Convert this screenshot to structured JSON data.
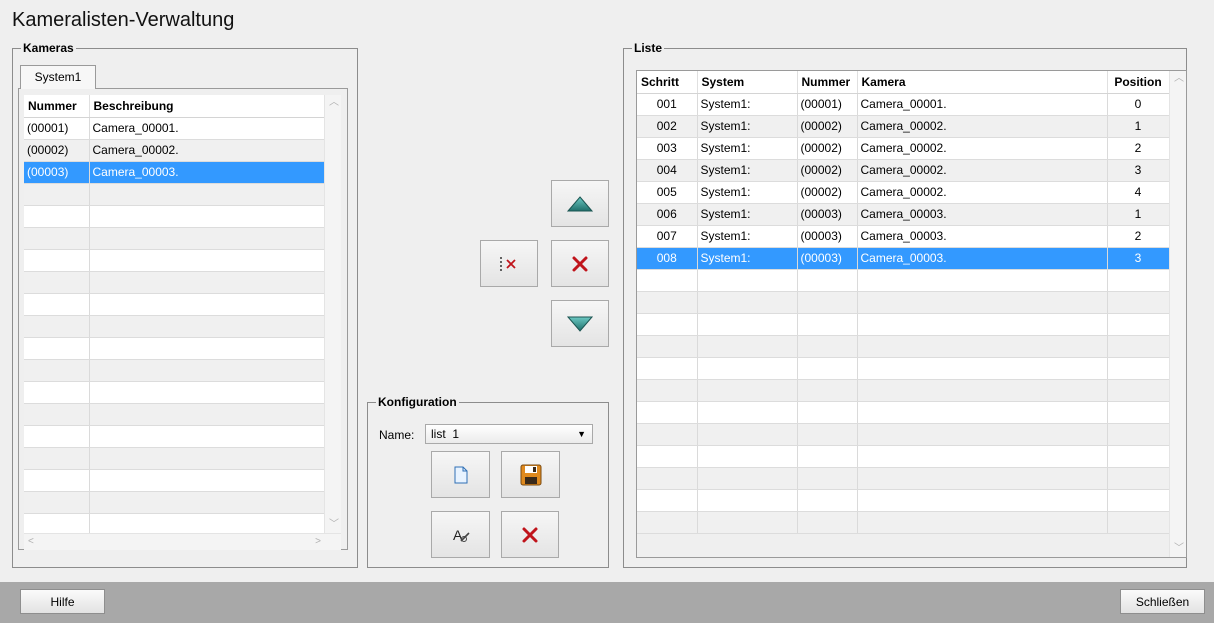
{
  "window": {
    "title": "Kameralisten-Verwaltung"
  },
  "kameras": {
    "legend": "Kameras",
    "tab": "System1",
    "columns": [
      "Nummer",
      "Beschreibung"
    ],
    "rows": [
      [
        "(00001)",
        "Camera_00001."
      ],
      [
        "(00002)",
        "Camera_00002."
      ],
      [
        "(00003)",
        "Camera_00003."
      ]
    ],
    "selected_index": 2,
    "empty_rows": 16
  },
  "actions": {
    "move_up_icon": "triangle-up-icon",
    "remove_icon": "red-x-icon",
    "move_down_icon": "triangle-down-icon",
    "clear_icon": "dotted-x-icon"
  },
  "konfiguration": {
    "legend": "Konfiguration",
    "name_label": "Name:",
    "name_value": "list  1"
  },
  "liste": {
    "legend": "Liste",
    "columns": [
      "Schritt",
      "System",
      "Nummer",
      "Kamera",
      "Position"
    ],
    "rows": [
      [
        "001",
        "System1:",
        "(00001)",
        "Camera_00001.",
        "0"
      ],
      [
        "002",
        "System1:",
        "(00002)",
        "Camera_00002.",
        "1"
      ],
      [
        "003",
        "System1:",
        "(00002)",
        "Camera_00002.",
        "2"
      ],
      [
        "004",
        "System1:",
        "(00002)",
        "Camera_00002.",
        "3"
      ],
      [
        "005",
        "System1:",
        "(00002)",
        "Camera_00002.",
        "4"
      ],
      [
        "006",
        "System1:",
        "(00003)",
        "Camera_00003.",
        "1"
      ],
      [
        "007",
        "System1:",
        "(00003)",
        "Camera_00003.",
        "2"
      ],
      [
        "008",
        "System1:",
        "(00003)",
        "Camera_00003.",
        "3"
      ]
    ],
    "selected_index": 7,
    "empty_rows": 12
  },
  "footer": {
    "help": "Hilfe",
    "close": "Schließen"
  },
  "colors": {
    "selection": "#3399ff",
    "teal_arrow": "#2f8f8a",
    "red_x": "#c0141b"
  }
}
